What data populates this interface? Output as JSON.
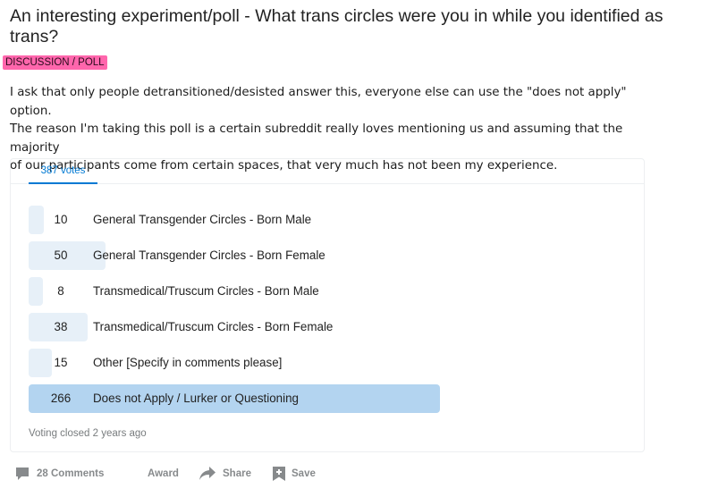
{
  "post": {
    "title": "An interesting experiment/poll - What trans circles were you in while you identified as trans?",
    "flair": "DISCUSSION / POLL",
    "body": [
      "I ask that only people detransitioned/desisted answer this, everyone else can use the \"does not apply\" option.",
      "The reason I'm taking this poll is a certain subreddit really loves mentioning us and assuming that the majority",
      "of our participants come from certain spaces, that very much has not been my experience."
    ]
  },
  "poll": {
    "votes_tab": "387 votes",
    "status": "Voting closed 2 years ago",
    "options": [
      {
        "count": "10",
        "label": "General Transgender Circles - Born Male",
        "fraction": 0.026
      },
      {
        "count": "50",
        "label": "General Transgender Circles - Born Female",
        "fraction": 0.129
      },
      {
        "count": "8",
        "label": "Transmedical/Truscum Circles - Born Male",
        "fraction": 0.021
      },
      {
        "count": "38",
        "label": "Transmedical/Truscum Circles - Born Female",
        "fraction": 0.098
      },
      {
        "count": "15",
        "label": "Other [Specify in comments please]",
        "fraction": 0.039
      },
      {
        "count": "266",
        "label": "Does not Apply / Lurker or Questioning",
        "fraction": 0.687
      }
    ]
  },
  "actions": {
    "comments": "28 Comments",
    "award": "Award",
    "share": "Share",
    "save": "Save"
  },
  "icons": {
    "comments": "speech-bubble-icon",
    "share": "share-arrow-icon",
    "save": "bookmark-plus-icon"
  },
  "colors": {
    "flair_bg": "#ff66ac",
    "accent": "#0079d3",
    "bar": "#e7f0f8",
    "bar_winner": "#b3d4f0"
  }
}
